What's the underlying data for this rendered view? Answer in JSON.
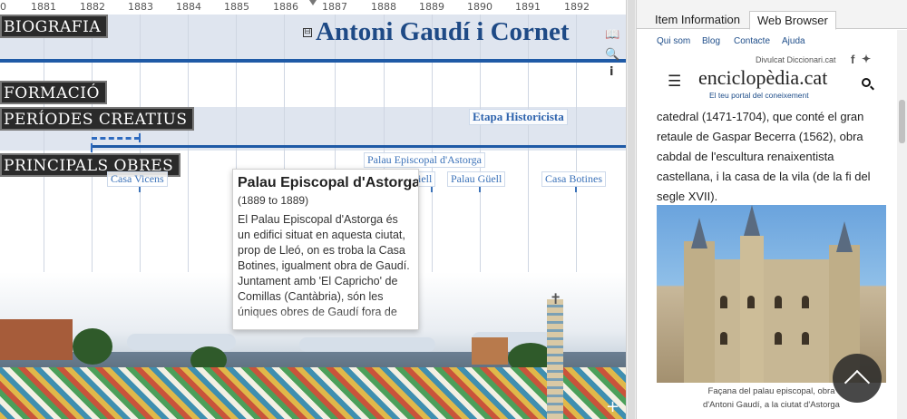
{
  "timeline": {
    "ruler_years": [
      "0",
      "1881",
      "1882",
      "1883",
      "1884",
      "1885",
      "1886",
      "1887",
      "1888",
      "1889",
      "1890",
      "1891",
      "1892"
    ],
    "title": "Antoni Gaudí i Cornet",
    "sections": {
      "biografia": "BIOGRAFIA",
      "formacio": "FORMACIÓ",
      "periodes": "PERÍODES CREATIUS",
      "obres": "PRINCIPALS OBRES"
    },
    "periods": [
      {
        "label": "Etapa Historicista"
      }
    ],
    "works": [
      {
        "label": "Palau Episcopal d'Astorga"
      },
      {
        "label": "Casa Vicens"
      },
      {
        "label": "iell"
      },
      {
        "label": "Palau Güell"
      },
      {
        "label": "Casa Botines"
      }
    ],
    "tools": {
      "info": "i",
      "collapse": "⊟",
      "expand": "+"
    }
  },
  "popup": {
    "title": "Palau Episcopal d'Astorga",
    "dates": "(1889 to 1889)",
    "body": "El Palau Episcopal d'Astorga és un edifici situat en aquesta ciutat, prop de Lleó, on es troba la Casa Botines, igualment obra de Gaudí. Juntament amb 'El Capricho' de Comillas (Cantàbria), són les úniques obres de Gaudí fora de"
  },
  "side_panel": {
    "tabs": [
      {
        "label": "Item Information",
        "active": false
      },
      {
        "label": "Web Browser",
        "active": true
      }
    ],
    "browser_nav": [
      "Qui som",
      "Blog",
      "Contacte",
      "Ajuda"
    ],
    "top_links": "Divulcat  Diccionari.cat",
    "social": {
      "facebook": "f",
      "twitter": "t"
    },
    "logo": "enciclopèdia.cat",
    "tagline": "El teu portal del coneixement",
    "article_lines": [
      "catedral (1471-1704), que conté el gran",
      "retaule de Gaspar Becerra (1562), obra",
      "cabdal de l'escultura renaixentista",
      "castellana, i la casa de la vila (de la fi del",
      "segle XVII)."
    ],
    "caption_lines": [
      "Façana del palau episcopal, obra",
      "d'Antoni Gaudí, a la ciutat d'Astorga"
    ]
  },
  "colors": {
    "accent_blue": "#1f5aa6",
    "label_blue": "#3b72b9",
    "band": "#dfe5ef",
    "section_bg": "#2a2a2a"
  }
}
